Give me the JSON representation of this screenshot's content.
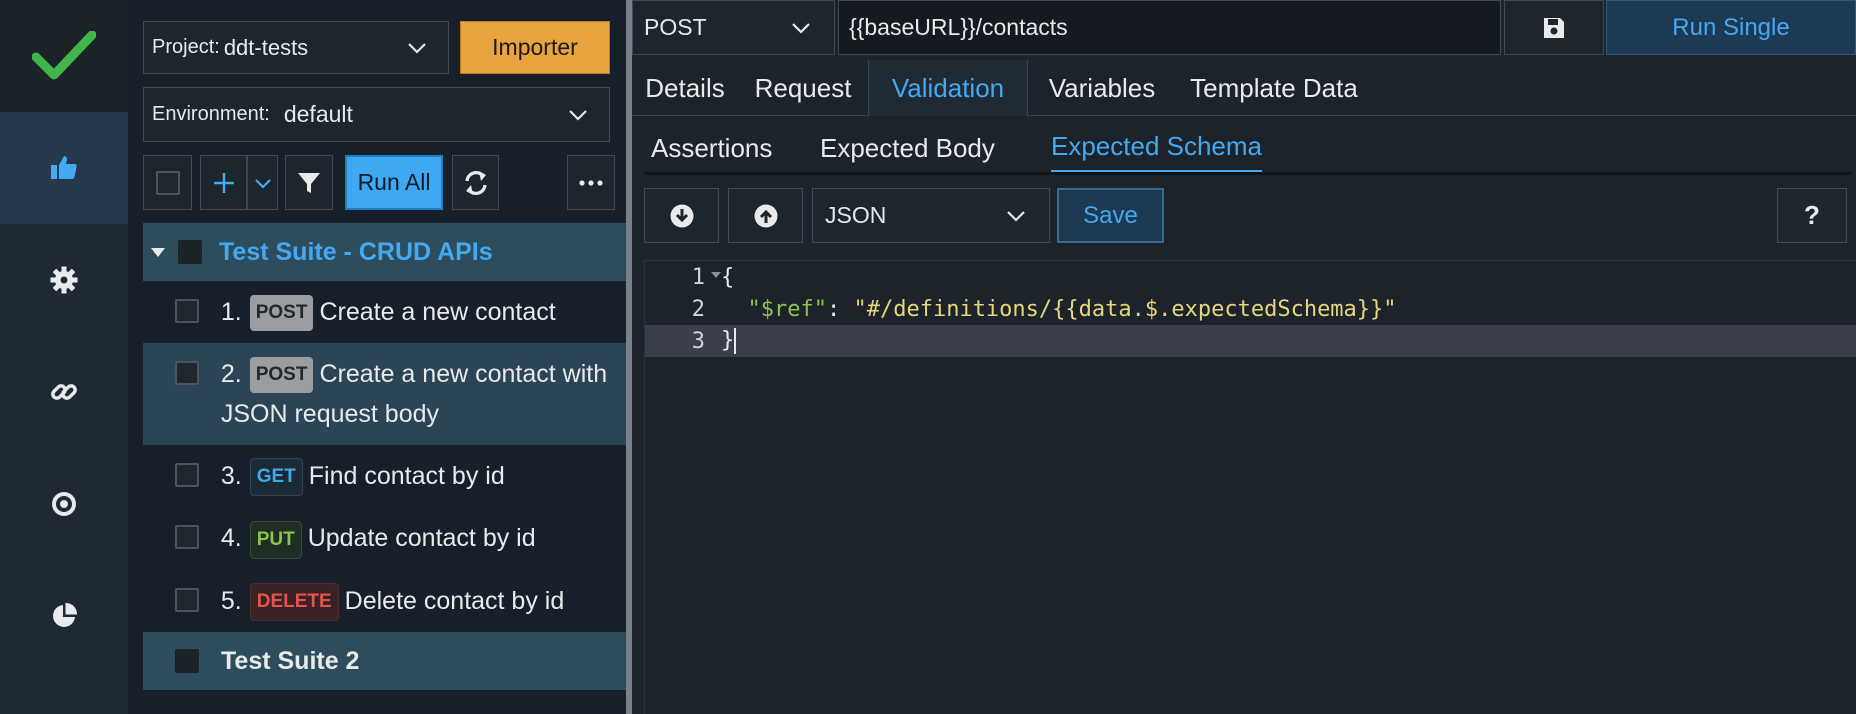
{
  "rail": {
    "logo_icon": "checkmark-icon",
    "items": [
      {
        "icon": "thumbs-up-icon",
        "active": true
      },
      {
        "icon": "gear-icon"
      },
      {
        "icon": "link-icon"
      },
      {
        "icon": "target-icon"
      },
      {
        "icon": "pie-chart-icon"
      }
    ]
  },
  "sidebar": {
    "project_label": "Project:",
    "project_value": "ddt-tests",
    "importer_label": "Importer",
    "environment_label": "Environment:",
    "environment_value": "default",
    "run_all_label": "Run All",
    "suites": [
      {
        "title": "Test Suite - CRUD APIs",
        "cases": [
          {
            "num": "1.",
            "method": "POST",
            "name": "Create a new contact"
          },
          {
            "num": "2.",
            "method": "POST",
            "name": "Create a new contact with JSON request body"
          },
          {
            "num": "3.",
            "method": "GET",
            "name": "Find contact by id"
          },
          {
            "num": "4.",
            "method": "PUT",
            "name": "Update contact by id"
          },
          {
            "num": "5.",
            "method": "DELETE",
            "name": "Delete contact by id"
          }
        ]
      },
      {
        "title": "Test Suite 2"
      }
    ]
  },
  "request": {
    "method": "POST",
    "url": "{{baseURL}}/contacts",
    "run_single_label": "Run Single"
  },
  "tabs": [
    "Details",
    "Request",
    "Validation",
    "Variables",
    "Template Data"
  ],
  "subtabs": [
    "Assertions",
    "Expected Body",
    "Expected Schema"
  ],
  "editor": {
    "format": "JSON",
    "save_label": "Save",
    "help_label": "?",
    "lines": [
      {
        "n": "1",
        "open": "{"
      },
      {
        "n": "2",
        "key": "\"$ref\"",
        "sep": ": ",
        "value": "\"#/definitions/{{data.$.expectedSchema}}\""
      },
      {
        "n": "3",
        "close": "}"
      }
    ]
  },
  "colors": {
    "accent": "#43a9f2",
    "importer": "#e7a33e",
    "post": "#9a9ea2",
    "get": "#3ea9f0",
    "put": "#8cc34a",
    "delete": "#e2554f"
  }
}
